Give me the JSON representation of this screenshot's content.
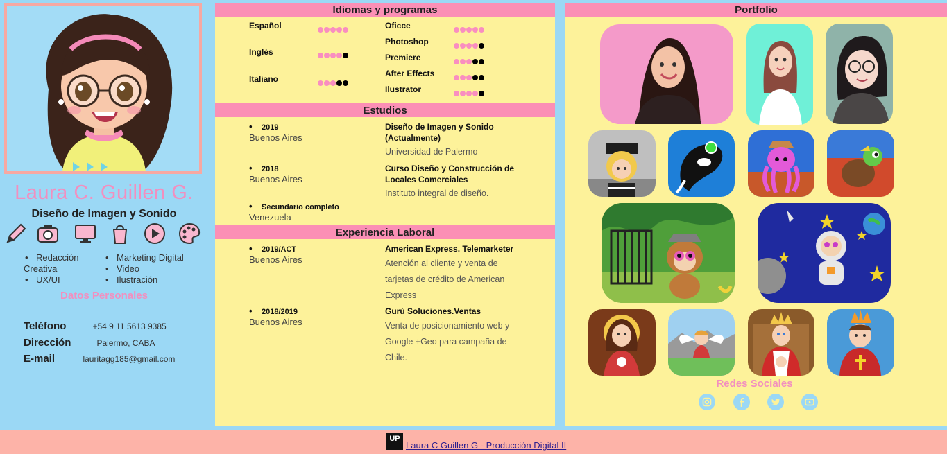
{
  "profile": {
    "name": "Laura C. Guillen G.",
    "subtitle": "Diseño de Imagen y Sonido",
    "skills_col_a": [
      "Redacción Creativa",
      "UX/UI"
    ],
    "skills_col_b": [
      "Marketing Digital",
      "Video",
      "Ilustración"
    ],
    "skill_icons": [
      "pencil-icon",
      "camera-icon",
      "monitor-icon",
      "shopping-bag-icon",
      "play-icon",
      "palette-icon"
    ],
    "personal_title": "Datos Personales",
    "contacts": [
      {
        "label": "Teléfono",
        "value": "+54 9 11 5613 9385"
      },
      {
        "label": "Dirección",
        "value": "Palermo, CABA"
      },
      {
        "label": "E-mail",
        "value": "lauritagg185@gmail.com"
      }
    ]
  },
  "languages": {
    "title": "Idiomas y programas",
    "langs": [
      {
        "name": "Español",
        "level": 5
      },
      {
        "name": "Inglés",
        "level": 4
      },
      {
        "name": "Italiano",
        "level": 3
      }
    ],
    "programs": [
      {
        "name": "Oficce",
        "level": 5
      },
      {
        "name": "Photoshop",
        "level": 4
      },
      {
        "name": "Premiere",
        "level": 3
      },
      {
        "name": "After Effects",
        "level": 3
      },
      {
        "name": "Ilustrator",
        "level": 4
      }
    ]
  },
  "studies": {
    "title": "Estudios",
    "items": [
      {
        "year": "2019",
        "place": "Buenos Aires",
        "title": "Diseño de Imagen y Sonido (Actualmente)",
        "desc": "Universidad de Palermo"
      },
      {
        "year": "2018",
        "place": "Buenos Aires",
        "title": "Curso Diseño y Construcción de Locales Comerciales",
        "desc": "Instituto integral de diseño."
      },
      {
        "year": "Secundario completo",
        "place": "Venezuela",
        "title": "",
        "desc": ""
      }
    ]
  },
  "experience": {
    "title": "Experiencia Laboral",
    "items": [
      {
        "year": "2019/ACT",
        "place": "Buenos Aires",
        "title": "American Express. Telemarketer",
        "desc": "Atención al cliente y venta de tarjetas de crédito de American Express"
      },
      {
        "year": "2018/2019",
        "place": "Buenos Aires",
        "title": "Gurú Soluciones.Ventas",
        "desc": "Venta de posicionamiento web y Google +Geo para campaña de Chile."
      }
    ]
  },
  "portfolio": {
    "title": "Portfolio",
    "social_title": "Redes Sociales",
    "social_icons": [
      "instagram-icon",
      "facebook-icon",
      "twitter-icon",
      "youtube-icon"
    ]
  },
  "footer": {
    "logo_text": "UP",
    "link": "Laura C Guillen G - Producción Digital II"
  },
  "colors": {
    "pink": "#fb8fb5",
    "yellow": "#fdf29a",
    "sky": "#9bd8f5",
    "salmon": "#fdb3a8",
    "dot_filled": "#f98ec0",
    "dot_empty": "#000000"
  }
}
